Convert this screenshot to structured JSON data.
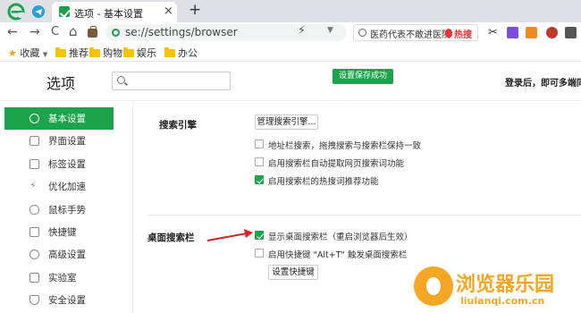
{
  "browser": {
    "tab_title": "选项 - 基本设置",
    "tab_close": "×",
    "new_tab": "+",
    "address": "se://settings/browser",
    "search_query": "医药代表不敢进医院",
    "hot_label": "热搜"
  },
  "nav": {
    "back": "←",
    "forward": "→",
    "reload": "C",
    "home": "⌂"
  },
  "bookmarks": {
    "favorites": "收藏",
    "items": [
      "推荐",
      "购物",
      "娱乐",
      "办公"
    ]
  },
  "settings": {
    "title": "选项",
    "search_value": "",
    "toast": "设置保存成功",
    "login_hint": "登录后，即可多端同"
  },
  "sidebar": {
    "items": [
      {
        "label": "基本设置",
        "icon": "settings-icon",
        "active": true
      },
      {
        "label": "界面设置",
        "icon": "window-icon",
        "active": false
      },
      {
        "label": "标签设置",
        "icon": "tab-icon",
        "active": false
      },
      {
        "label": "优化加速",
        "icon": "lightning-icon",
        "active": false
      },
      {
        "label": "鼠标手势",
        "icon": "mouse-icon",
        "active": false
      },
      {
        "label": "快捷键",
        "icon": "keyboard-icon",
        "active": false
      },
      {
        "label": "高级设置",
        "icon": "advanced-icon",
        "active": false
      },
      {
        "label": "实验室",
        "icon": "lab-icon",
        "active": false
      },
      {
        "label": "安全设置",
        "icon": "shield-icon",
        "active": false
      }
    ]
  },
  "search_engine": {
    "label": "搜索引擎",
    "manage_button": "管理搜索引擎...",
    "options": [
      {
        "label": "地址栏搜索，拖拽搜索与搜索栏保持一致",
        "checked": false
      },
      {
        "label": "启用搜索栏自动提取网页搜索词功能",
        "checked": false
      },
      {
        "label": "启用搜索栏的热搜词推荐功能",
        "checked": true
      }
    ]
  },
  "desktop_search": {
    "label": "桌面搜索栏",
    "options": [
      {
        "label": "显示桌面搜索栏（重启浏览器后生效）",
        "checked": true
      },
      {
        "label": "启用快捷键 \"Alt+T\" 触发桌面搜索栏",
        "checked": false
      }
    ],
    "shortcut_button": "设置快捷键"
  },
  "watermark": {
    "name": "浏览器乐园",
    "url": "liulanqi.com.cn"
  },
  "colors": {
    "accent": "#1ca34b",
    "arrow": "#d8232a",
    "watermark": "#f5a623"
  }
}
